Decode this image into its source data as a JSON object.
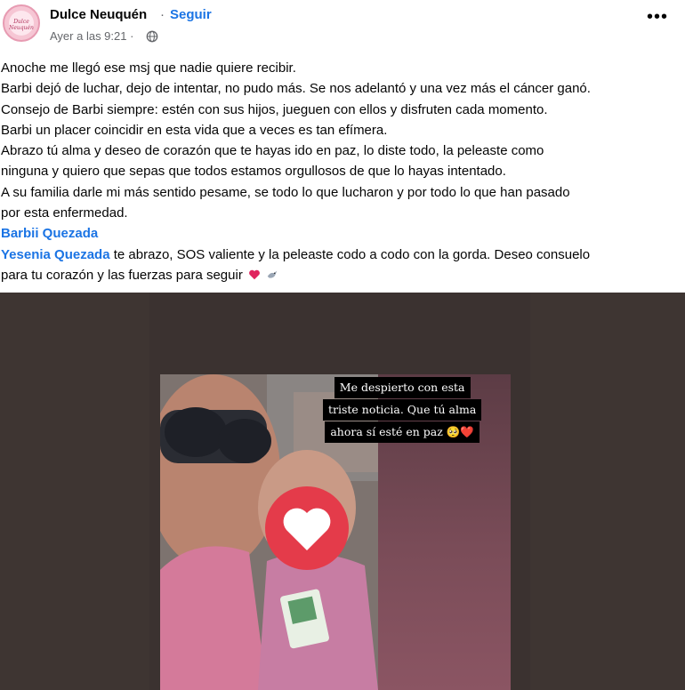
{
  "header": {
    "page_name": "Dulce Neuquén",
    "separator": "·",
    "follow_label": "Seguir",
    "timestamp": "Ayer a las 9:21 ·",
    "avatar_logo_text": "Dulce Neuquén",
    "more_label": "•••"
  },
  "post": {
    "lines": [
      "Anoche me llegó ese msj que nadie quiere recibir.",
      "Barbi dejó de luchar, dejo de intentar, no pudo más. Se nos adelantó y una vez más el cáncer ganó.",
      "Consejo de Barbi siempre: estén con sus hijos, jueguen con ellos y disfruten cada momento.",
      "Barbi un placer coincidir en esta vida que a veces es tan efímera.",
      "Abrazo tú alma y deseo de corazón que te hayas ido en paz, lo diste todo, la peleaste como",
      "ninguna y quiero que sepas que todos estamos orgullosos de que lo hayas intentado.",
      "A su familia darle mi más sentido pesame, se todo lo que lucharon y por todo lo que han pasado",
      "por esta enfermedad."
    ],
    "mention_1": "Barbii Quezada",
    "mention_2": "Yesenia Quezada",
    "mention_2_text": " te abrazo, SOS valiente y la peleaste codo a codo con la gorda. Deseo consuelo",
    "last_line": "para tu corazón y las fuerzas para seguir"
  },
  "photo": {
    "caption_lines": [
      "Me despierto con esta",
      "triste noticia. Que tú alma",
      "ahora sí esté en paz 🥺❤️"
    ]
  },
  "colors": {
    "link": "#1b74e4",
    "secondary_text": "#65676b",
    "photo_bg": "#3e3532"
  }
}
